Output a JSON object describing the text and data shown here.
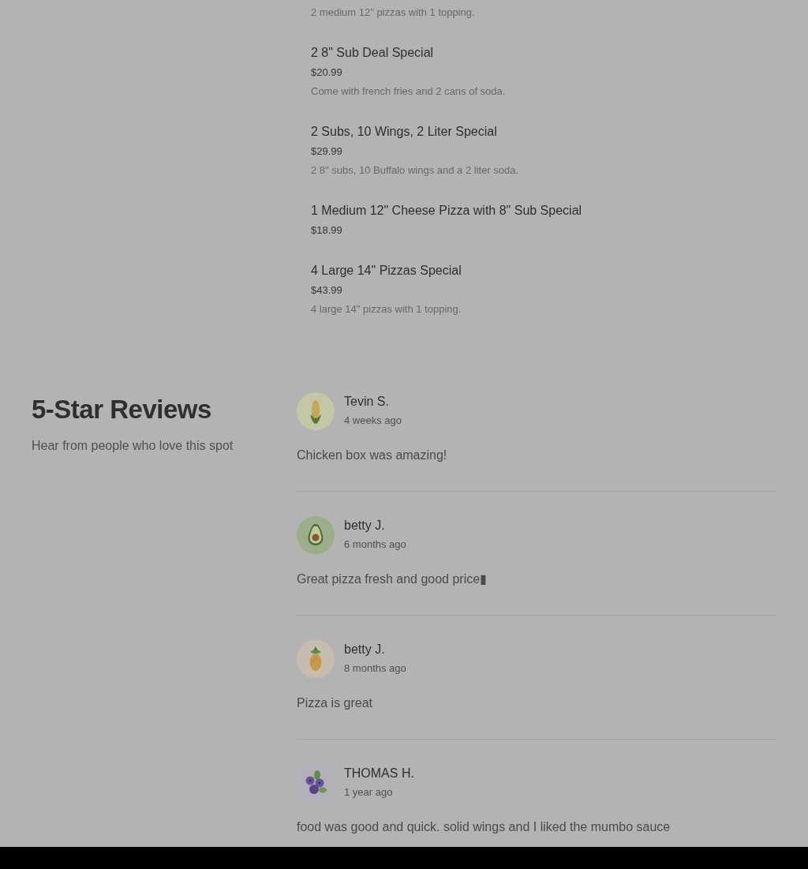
{
  "menu": {
    "items": [
      {
        "description": "2 medium 12\" pizzas with 1 topping."
      },
      {
        "title": "2 8\" Sub Deal Special",
        "price": "$20.99",
        "description": "Come with french fries and 2 cans of soda."
      },
      {
        "title": "2 Subs, 10 Wings, 2 Liter Special",
        "price": "$29.99",
        "description": "2 8\" subs, 10 Buffalo wings and a 2 liter soda."
      },
      {
        "title": "1 Medium 12\" Cheese Pizza with 8\" Sub Special",
        "price": "$18.99"
      },
      {
        "title": "4 Large 14\" Pizzas Special",
        "price": "$43.99",
        "description": "4 large 14\" pizzas with 1 topping."
      }
    ]
  },
  "reviews": {
    "title": "5-Star Reviews",
    "subtitle": "Hear from people who love this spot",
    "items": [
      {
        "kind": "corn",
        "name": "Tevin S.",
        "time": "4 weeks ago",
        "text": "Chicken box was amazing!"
      },
      {
        "kind": "avocado",
        "name": "betty J.",
        "time": "6 months ago",
        "text": "Great pizza fresh and good price▮"
      },
      {
        "kind": "pineapple",
        "name": "betty J.",
        "time": "8 months ago",
        "text": "Pizza is great"
      },
      {
        "kind": "berries",
        "name": "THOMAS H.",
        "time": "1 year ago",
        "text": "food was good and quick. solid wings and I liked the mumbo sauce"
      }
    ]
  }
}
